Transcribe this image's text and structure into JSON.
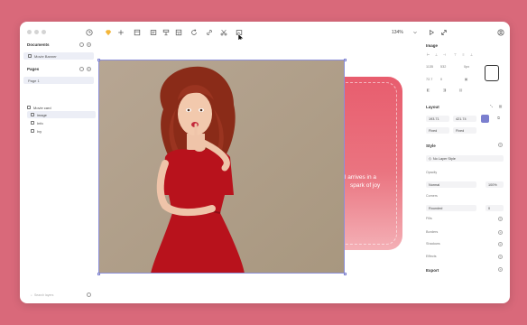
{
  "window": {
    "zoom": "134%",
    "cursor": "arrow-pointer-icon"
  },
  "sidebar": {
    "documents_label": "Documents",
    "document_item": "Movie Banner",
    "pages_label": "Pages",
    "page_item": "Page 1",
    "layers": [
      {
        "label": "Movie card",
        "icon": "frame-icon"
      },
      {
        "label": "image",
        "icon": "image-icon"
      },
      {
        "label": "Info",
        "icon": "folder-icon"
      },
      {
        "label": "Ivy",
        "icon": "folder-icon"
      }
    ],
    "search_placeholder": "Search layers"
  },
  "canvas": {
    "card_text_line1": "l arrives in a",
    "card_text_line2": "spark of joy",
    "card_color": "#e85d6e"
  },
  "panel": {
    "image_label": "Image",
    "image_fields": [
      "1135",
      "532",
      "0px",
      "72.7",
      "0"
    ],
    "layout_label": "Layout",
    "layout_fields": [
      "193.71",
      "421.74"
    ],
    "fixed_w": "Fixed",
    "fixed_h": "Fixed",
    "style_label": "Style",
    "no_style": "No Layer Style",
    "opacity_label": "Opacity",
    "blend_mode": "Normal",
    "opacity_value": "100%",
    "corners_label": "Corners",
    "corners_mode": "Rounded",
    "corners_value": "0",
    "fills_label": "Fills",
    "borders_label": "Borders",
    "shadows_label": "Shadows",
    "effects_label": "Effects",
    "export_label": "Export"
  },
  "colors": {
    "background": "#d9697a",
    "selection": "#8c8fd8",
    "accent": "#7b7fcf"
  }
}
